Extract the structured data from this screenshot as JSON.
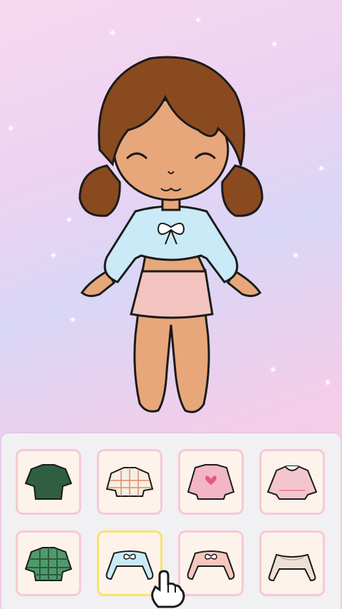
{
  "scene": {
    "character": {
      "name_icon": "chibi-girl",
      "hair_color": "#8a4a1f",
      "skin_color": "#e8a77a",
      "top_color": "#c9eaf6",
      "skirt_color": "#f4c4c0"
    }
  },
  "wardrobe": {
    "selected_index": 5,
    "items": [
      {
        "icon": "green-sweater-icon",
        "color": "#2f5f40"
      },
      {
        "icon": "plaid-crop-top-icon",
        "color": "#f6efe4"
      },
      {
        "icon": "pink-heart-sweater-icon",
        "color": "#f2b6c7"
      },
      {
        "icon": "pink-collar-sweater-icon",
        "color": "#f3c5cf"
      },
      {
        "icon": "green-plaid-sweater-icon",
        "color": "#4f9a6b"
      },
      {
        "icon": "blue-bow-crop-top-icon",
        "color": "#c9eaf6"
      },
      {
        "icon": "peach-bow-crop-top-icon",
        "color": "#f7c7bd"
      },
      {
        "icon": "beige-off-shoulder-top-icon",
        "color": "#efe0d6"
      }
    ]
  }
}
